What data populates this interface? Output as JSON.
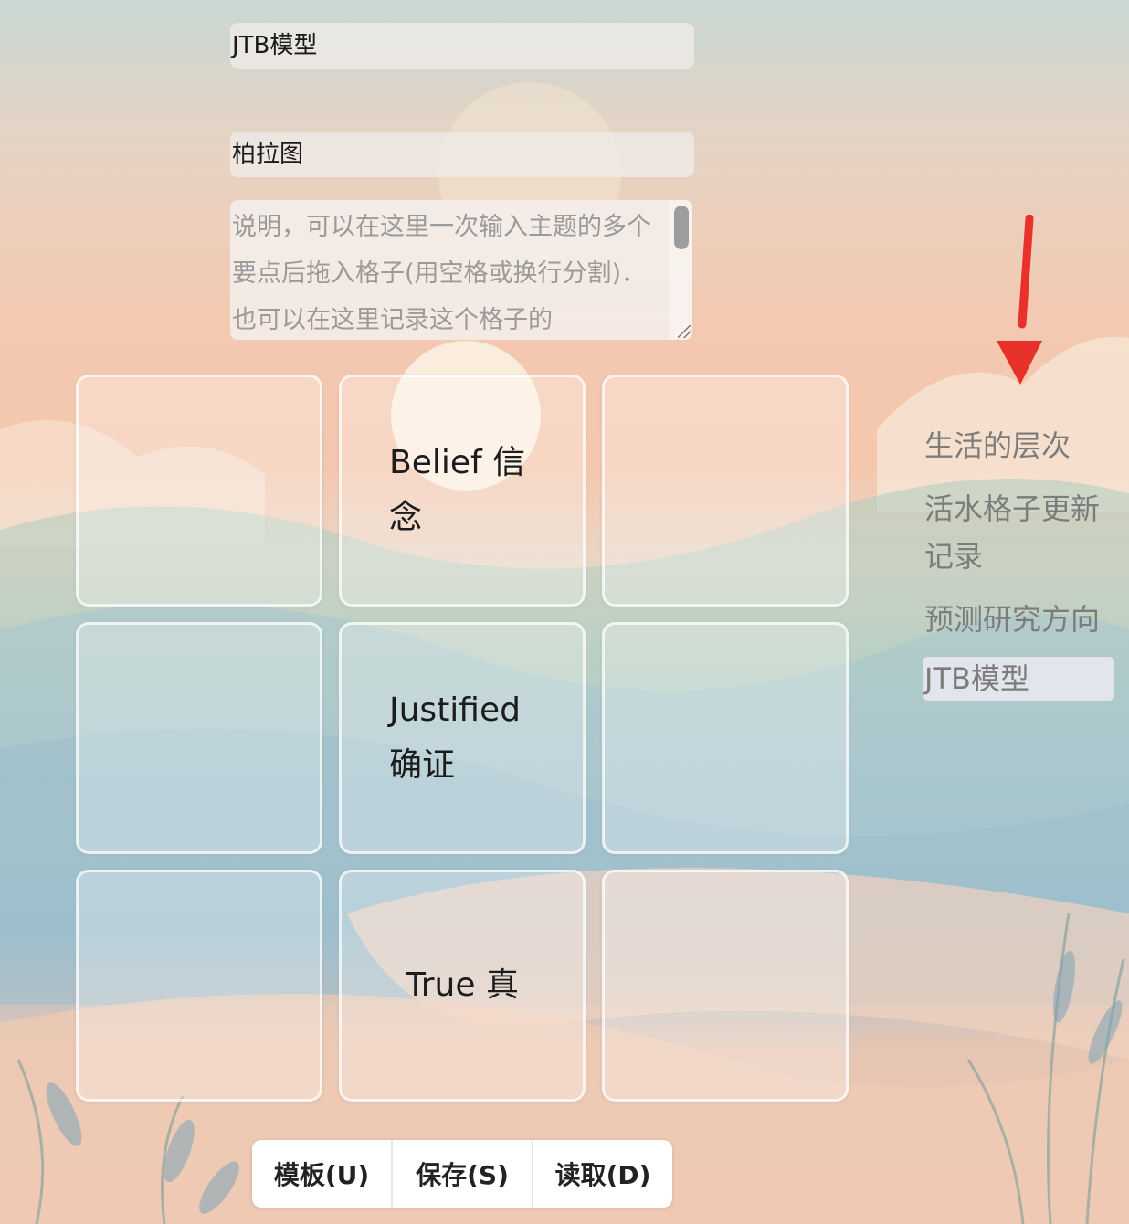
{
  "topic": {
    "title": "JTB模型",
    "subtitle": "柏拉图"
  },
  "notes": {
    "text": "说明，可以在这里一次输入主题的多个要点后拖入格子(用空格或换行分割)．也可以在这里记录这个格子的"
  },
  "grid": {
    "cells": [
      {
        "text": ""
      },
      {
        "text": "Belief 信念"
      },
      {
        "text": ""
      },
      {
        "text": ""
      },
      {
        "text": "Justified 确证"
      },
      {
        "text": ""
      },
      {
        "text": ""
      },
      {
        "text": "True 真"
      },
      {
        "text": ""
      }
    ]
  },
  "sidebar": {
    "items": [
      {
        "label": "生活的层次"
      },
      {
        "label": "活水格子更新记录"
      },
      {
        "label": "预测研究方向"
      },
      {
        "label": "JTB模型"
      }
    ],
    "active_index": 3
  },
  "toolbar": {
    "template_label": "模板(U)",
    "save_label": "保存(S)",
    "load_label": "读取(D)"
  },
  "colors": {
    "arrow": "#e8312a"
  }
}
